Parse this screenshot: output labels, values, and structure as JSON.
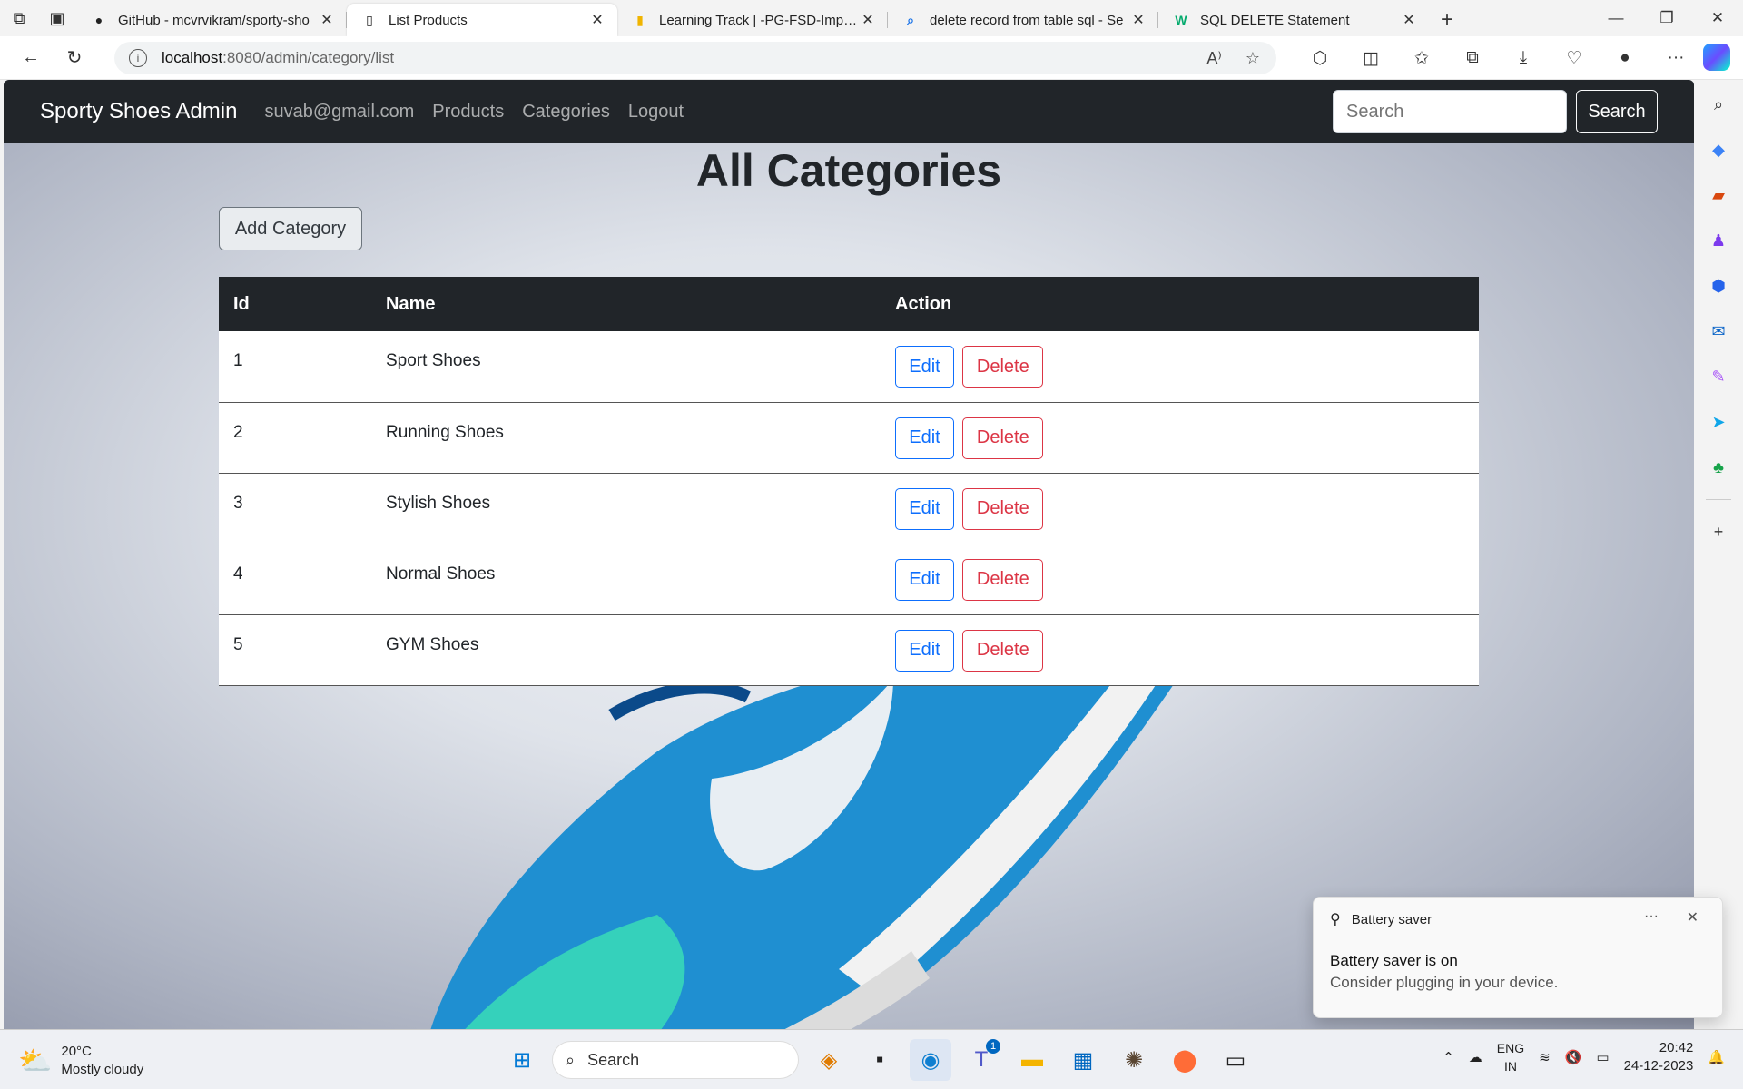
{
  "browser": {
    "tabs": [
      {
        "title": "GitHub - mcvrvikram/sporty-sho",
        "active": false
      },
      {
        "title": "List Products",
        "active": true
      },
      {
        "title": "Learning Track | -PG-FSD-Implen",
        "active": false
      },
      {
        "title": "delete record from table sql - Se",
        "active": false
      },
      {
        "title": "SQL DELETE Statement",
        "active": false
      }
    ],
    "url_host": "localhost",
    "url_path": ":8080/admin/category/list"
  },
  "navbar": {
    "brand": "Sporty Shoes Admin",
    "links": [
      "suvab@gmail.com",
      "Products",
      "Categories",
      "Logout"
    ],
    "search_placeholder": "Search",
    "search_button": "Search"
  },
  "main": {
    "title": "All Categories",
    "add_button": "Add Category",
    "table": {
      "headers": [
        "Id",
        "Name",
        "Action"
      ],
      "rows": [
        {
          "id": "1",
          "name": "Sport Shoes"
        },
        {
          "id": "2",
          "name": "Running Shoes"
        },
        {
          "id": "3",
          "name": "Stylish Shoes"
        },
        {
          "id": "4",
          "name": "Normal Shoes"
        },
        {
          "id": "5",
          "name": "GYM Shoes"
        }
      ],
      "edit_label": "Edit",
      "delete_label": "Delete"
    }
  },
  "toast": {
    "app": "Battery saver",
    "more": "···",
    "message": "Battery saver is on",
    "detail": "Consider plugging in your device."
  },
  "taskbar": {
    "temperature": "20°C",
    "weather": "Mostly cloudy",
    "search": "Search",
    "teams_badge": "1",
    "lang_top": "ENG",
    "lang_bottom": "IN",
    "time": "20:42",
    "date": "24-12-2023"
  },
  "colors": {
    "navbar_bg": "#212529",
    "edit": "#0d6efd",
    "delete": "#dc3545"
  }
}
